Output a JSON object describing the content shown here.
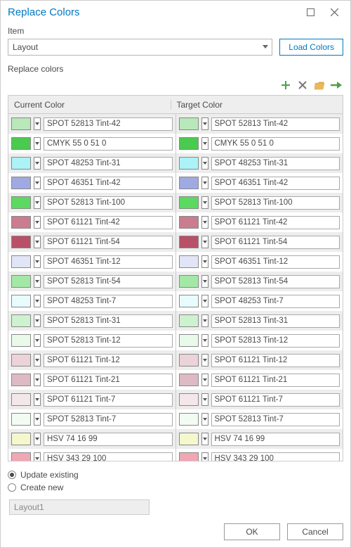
{
  "window": {
    "title": "Replace Colors"
  },
  "item_label": "Item",
  "item_value": "Layout",
  "load_colors": "Load Colors",
  "replace_colors_label": "Replace colors",
  "columns": {
    "current": "Current Color",
    "target": "Target Color"
  },
  "rows": [
    {
      "swatch": "#b9e8bb",
      "name": "SPOT 52813 Tint-42"
    },
    {
      "swatch": "#4acb4f",
      "name": "CMYK 55 0 51 0"
    },
    {
      "swatch": "#abf3f7",
      "name": "SPOT 48253 Tint-31"
    },
    {
      "swatch": "#9fa9e2",
      "name": "SPOT 46351 Tint-42"
    },
    {
      "swatch": "#5bd960",
      "name": "SPOT 52813 Tint-100"
    },
    {
      "swatch": "#c97d8f",
      "name": "SPOT 61121 Tint-42"
    },
    {
      "swatch": "#b95068",
      "name": "SPOT 61121 Tint-54"
    },
    {
      "swatch": "#e2e5f6",
      "name": "SPOT 46351 Tint-12"
    },
    {
      "swatch": "#a4e8a7",
      "name": "SPOT 52813 Tint-54"
    },
    {
      "swatch": "#e9fcfd",
      "name": "SPOT 48253 Tint-7"
    },
    {
      "swatch": "#cdf2cf",
      "name": "SPOT 52813 Tint-31"
    },
    {
      "swatch": "#e9faea",
      "name": "SPOT 52813 Tint-12"
    },
    {
      "swatch": "#ecd3d9",
      "name": "SPOT 61121 Tint-12"
    },
    {
      "swatch": "#debac4",
      "name": "SPOT 61121 Tint-21"
    },
    {
      "swatch": "#f4e7ea",
      "name": "SPOT 61121 Tint-7"
    },
    {
      "swatch": "#f3fcf3",
      "name": "SPOT 52813 Tint-7"
    },
    {
      "swatch": "#f4f8cc",
      "name": "HSV 74 16 99"
    },
    {
      "swatch": "#f1a7b4",
      "name": "HSV 343 29 100"
    }
  ],
  "radio": {
    "update": "Update existing",
    "create": "Create new",
    "selected": "update"
  },
  "newname": "Layout1",
  "buttons": {
    "ok": "OK",
    "cancel": "Cancel"
  },
  "icons": {
    "plus": "#4aa24a",
    "x": "#7a7a7a",
    "folder": "#d9a43a",
    "arrow": "#4aa24a"
  }
}
